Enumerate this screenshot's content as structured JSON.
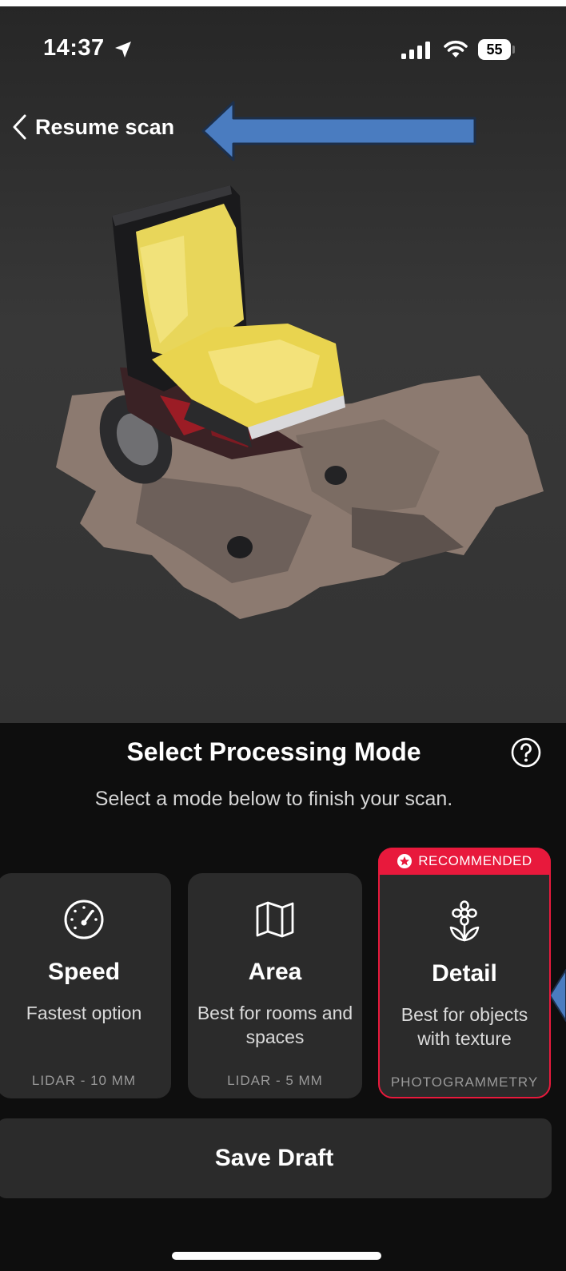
{
  "status_bar": {
    "time": "14:37",
    "battery_level": "55",
    "icons": [
      "location-arrow-icon",
      "cellular-signal-icon",
      "wifi-icon",
      "battery-icon"
    ]
  },
  "nav": {
    "back_label": "Resume scan",
    "back_icon": "chevron-left-icon"
  },
  "annotation": {
    "arrow_color": "#4a7cc0"
  },
  "preview": {
    "icon": "3d-model-wheelchair"
  },
  "sheet": {
    "title": "Select Processing Mode",
    "subtitle": "Select a mode below to finish your scan.",
    "help_icon": "question-circle-icon"
  },
  "modes": [
    {
      "name": "Speed",
      "description": "Fastest option",
      "tech": "LIDAR - 10 MM",
      "icon": "speedometer-icon",
      "selected": false
    },
    {
      "name": "Area",
      "description": "Best for rooms and spaces",
      "tech": "LIDAR - 5 MM",
      "icon": "map-icon",
      "selected": false
    },
    {
      "name": "Detail",
      "description": "Best for objects with texture",
      "tech": "PHOTOGRAMMETRY",
      "icon": "flower-icon",
      "selected": true,
      "badge": "RECOMMENDED"
    }
  ],
  "save_button": {
    "label": "Save Draft"
  },
  "colors": {
    "accent": "#e8193c",
    "card": "#2b2b2b",
    "sheet_bg": "#0e0e0e"
  }
}
